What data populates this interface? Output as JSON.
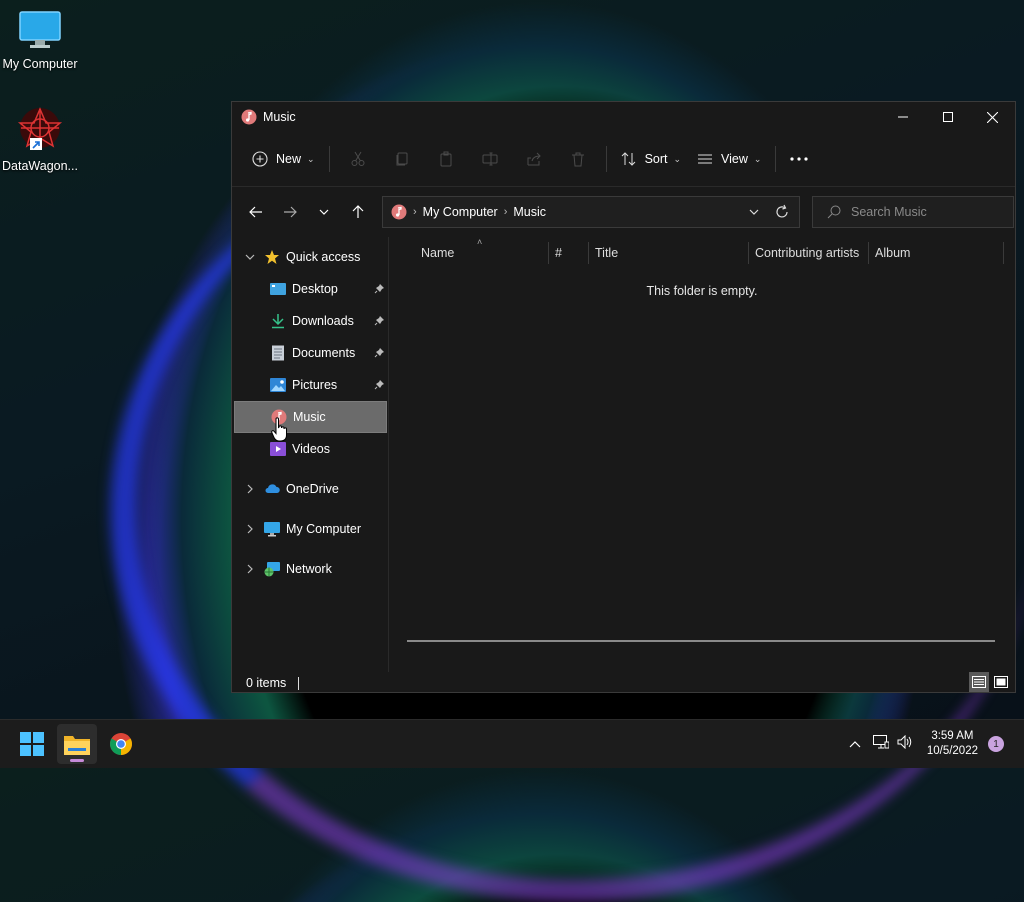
{
  "desktop": {
    "icons": [
      {
        "label": "My Computer",
        "icon": "monitor-icon"
      },
      {
        "label": "DataWagon...",
        "icon": "datawagon-shortcut-icon"
      }
    ]
  },
  "window": {
    "title": "Music",
    "controls": {
      "minimize": "minimize-icon",
      "maximize": "maximize-icon",
      "close": "close-icon"
    },
    "toolbar": {
      "new_label": "New",
      "sort_label": "Sort",
      "view_label": "View"
    },
    "address": {
      "crumbs": [
        "My Computer",
        "Music"
      ]
    },
    "search": {
      "placeholder": "Search Music"
    },
    "nav": {
      "quick_access": "Quick access",
      "items": [
        {
          "label": "Desktop",
          "pinned": true
        },
        {
          "label": "Downloads",
          "pinned": true
        },
        {
          "label": "Documents",
          "pinned": true
        },
        {
          "label": "Pictures",
          "pinned": true
        },
        {
          "label": "Music",
          "pinned": false,
          "selected": true
        },
        {
          "label": "Videos",
          "pinned": false
        }
      ],
      "onedrive": "OneDrive",
      "my_computer": "My Computer",
      "network": "Network"
    },
    "columns": [
      "Name",
      "#",
      "Title",
      "Contributing artists",
      "Album"
    ],
    "empty_message": "This folder is empty.",
    "status": {
      "items": "0 items"
    }
  },
  "taskbar": {
    "apps": [
      "start-icon",
      "file-explorer-icon",
      "chrome-icon"
    ],
    "clock": {
      "time": "3:59 AM",
      "date": "10/5/2022"
    },
    "notification_count": "1"
  },
  "colors": {
    "window_bg": "#191919",
    "selected_bg": "#6b6b6b",
    "taskbar_bg": "#1c1c1c",
    "accent": "#c9a3df"
  }
}
